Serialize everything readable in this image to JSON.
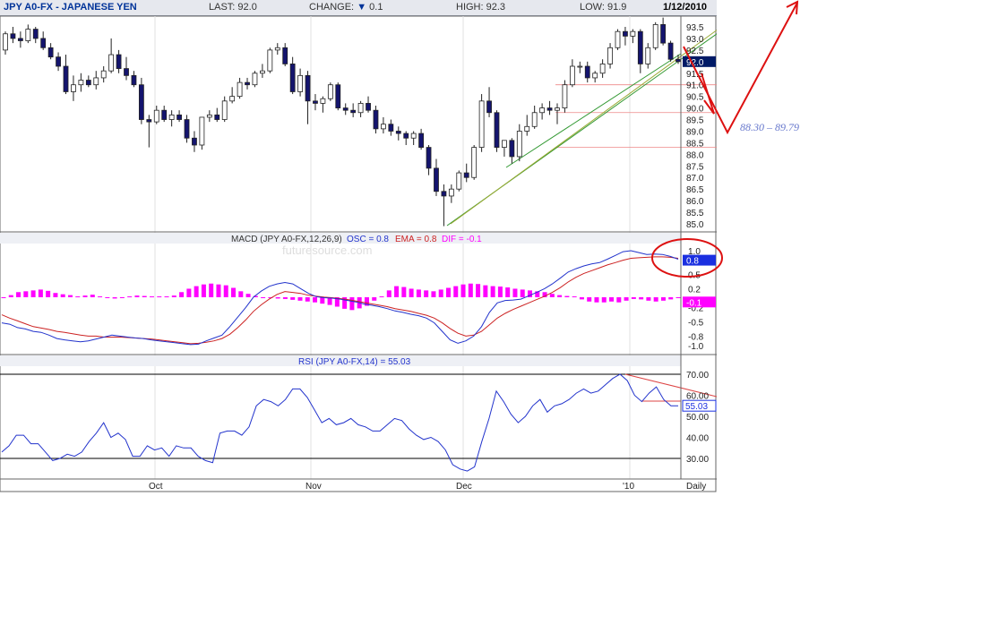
{
  "header": {
    "symbol": "JPY A0-FX - JAPANESE YEN",
    "last": "LAST: 92.0",
    "change_label": "CHANGE:",
    "change_arrow": "▼",
    "change_value": "0.1",
    "high": "HIGH: 92.3",
    "low": "LOW: 91.9",
    "date": "1/12/2010"
  },
  "watermark": "futuresource.com",
  "annotation": {
    "range": "88.30 – 89.79"
  },
  "colors": {
    "up_fill": "#ffffff",
    "down_fill": "#14146e",
    "macd": "#2233cc",
    "ema": "#cc2222",
    "dif": "#ff00ff",
    "rsi": "#2233cc",
    "annot": "#dd1111",
    "green_line": "#339933",
    "olive_line": "#99aa33"
  },
  "chart_data": [
    {
      "type": "candlestick",
      "title": "JPY A0-FX - JAPANESE YEN",
      "x_labels": [
        "Oct",
        "Nov",
        "Dec",
        "'10",
        "Daily"
      ],
      "y_ticks": [
        "93.5",
        "93.0",
        "92.5",
        "92.0",
        "91.5",
        "91.0",
        "90.5",
        "90.0",
        "89.5",
        "89.0",
        "88.5",
        "88.0",
        "87.5",
        "87.0",
        "86.5",
        "86.0",
        "85.5",
        "85.0"
      ],
      "ylim": [
        84.8,
        93.8
      ],
      "last_value_label": "92.0",
      "ohlc": [
        [
          92.5,
          93.3,
          92.3,
          93.2
        ],
        [
          93.2,
          93.5,
          92.8,
          93.0
        ],
        [
          93.0,
          93.3,
          92.6,
          92.9
        ],
        [
          92.9,
          93.6,
          92.8,
          93.4
        ],
        [
          93.4,
          93.5,
          92.8,
          93.0
        ],
        [
          93.0,
          93.3,
          92.5,
          92.6
        ],
        [
          92.6,
          92.8,
          92.1,
          92.2
        ],
        [
          92.2,
          92.4,
          91.6,
          91.8
        ],
        [
          91.8,
          92.3,
          90.6,
          90.7
        ],
        [
          90.7,
          91.4,
          90.3,
          91.0
        ],
        [
          91.0,
          91.5,
          90.7,
          91.2
        ],
        [
          91.2,
          91.4,
          90.9,
          91.0
        ],
        [
          91.0,
          91.6,
          90.8,
          91.3
        ],
        [
          91.3,
          91.8,
          91.1,
          91.6
        ],
        [
          91.6,
          93.0,
          91.5,
          92.3
        ],
        [
          92.3,
          92.5,
          91.5,
          91.7
        ],
        [
          91.7,
          92.2,
          91.2,
          91.4
        ],
        [
          91.4,
          91.6,
          90.9,
          91.0
        ],
        [
          91.0,
          91.3,
          89.3,
          89.5
        ],
        [
          89.5,
          89.7,
          88.3,
          89.4
        ],
        [
          89.4,
          90.1,
          89.3,
          89.9
        ],
        [
          89.9,
          90.1,
          89.4,
          89.5
        ],
        [
          89.5,
          89.9,
          89.2,
          89.7
        ],
        [
          89.7,
          89.9,
          89.4,
          89.5
        ],
        [
          89.5,
          89.7,
          88.5,
          88.7
        ],
        [
          88.7,
          89.0,
          88.1,
          88.4
        ],
        [
          88.4,
          89.6,
          88.2,
          89.6
        ],
        [
          89.6,
          89.9,
          89.4,
          89.7
        ],
        [
          89.7,
          90.0,
          89.4,
          89.5
        ],
        [
          89.5,
          90.5,
          89.4,
          90.3
        ],
        [
          90.3,
          90.9,
          90.2,
          90.5
        ],
        [
          90.5,
          91.3,
          90.4,
          91.1
        ],
        [
          91.1,
          91.3,
          90.8,
          91.0
        ],
        [
          91.0,
          91.6,
          90.9,
          91.5
        ],
        [
          91.5,
          91.9,
          91.3,
          91.6
        ],
        [
          91.6,
          92.6,
          91.5,
          92.5
        ],
        [
          92.5,
          92.8,
          92.3,
          92.6
        ],
        [
          92.6,
          92.8,
          91.8,
          91.9
        ],
        [
          91.9,
          92.2,
          90.6,
          90.7
        ],
        [
          90.7,
          91.7,
          90.5,
          91.4
        ],
        [
          91.4,
          91.6,
          89.3,
          90.3
        ],
        [
          90.3,
          90.6,
          89.9,
          90.2
        ],
        [
          90.2,
          90.5,
          89.8,
          90.4
        ],
        [
          90.4,
          91.1,
          90.3,
          91.0
        ],
        [
          91.0,
          91.1,
          89.9,
          90.0
        ],
        [
          90.0,
          90.2,
          89.7,
          89.9
        ],
        [
          89.9,
          90.2,
          89.6,
          89.8
        ],
        [
          89.8,
          90.3,
          89.6,
          90.2
        ],
        [
          90.2,
          90.5,
          89.8,
          89.9
        ],
        [
          89.9,
          90.1,
          88.9,
          89.1
        ],
        [
          89.1,
          89.6,
          88.9,
          89.3
        ],
        [
          89.3,
          89.5,
          88.8,
          89.0
        ],
        [
          89.0,
          89.2,
          88.6,
          88.9
        ],
        [
          88.9,
          89.0,
          88.4,
          88.7
        ],
        [
          88.7,
          89.0,
          88.4,
          88.9
        ],
        [
          88.9,
          89.1,
          88.2,
          88.3
        ],
        [
          88.3,
          88.4,
          87.1,
          87.4
        ],
        [
          87.4,
          87.8,
          86.2,
          86.4
        ],
        [
          86.4,
          86.7,
          84.9,
          86.2
        ],
        [
          86.2,
          86.7,
          85.9,
          86.5
        ],
        [
          86.5,
          87.3,
          86.4,
          87.2
        ],
        [
          87.2,
          87.6,
          86.8,
          87.0
        ],
        [
          87.0,
          88.4,
          86.9,
          88.3
        ],
        [
          88.3,
          90.6,
          88.1,
          90.3
        ],
        [
          90.3,
          90.9,
          89.6,
          89.8
        ],
        [
          89.8,
          89.9,
          88.1,
          88.3
        ],
        [
          88.3,
          88.6,
          87.9,
          88.6
        ],
        [
          88.6,
          88.7,
          87.6,
          87.9
        ],
        [
          87.9,
          89.3,
          87.7,
          89.0
        ],
        [
          89.0,
          89.7,
          88.8,
          89.2
        ],
        [
          89.2,
          90.1,
          89.1,
          89.8
        ],
        [
          89.8,
          90.2,
          89.5,
          90.0
        ],
        [
          90.0,
          90.3,
          89.7,
          89.9
        ],
        [
          89.9,
          90.2,
          89.3,
          90.0
        ],
        [
          90.0,
          91.2,
          89.8,
          91.0
        ],
        [
          91.0,
          92.1,
          90.9,
          91.8
        ],
        [
          91.8,
          92.0,
          91.5,
          91.8
        ],
        [
          91.8,
          92.0,
          91.1,
          91.3
        ],
        [
          91.3,
          91.6,
          91.1,
          91.5
        ],
        [
          91.5,
          92.1,
          91.3,
          91.9
        ],
        [
          91.9,
          92.8,
          91.7,
          92.6
        ],
        [
          92.6,
          93.4,
          92.5,
          93.3
        ],
        [
          93.3,
          93.5,
          92.7,
          93.1
        ],
        [
          93.1,
          93.4,
          92.8,
          93.3
        ],
        [
          93.3,
          93.4,
          91.5,
          91.9
        ],
        [
          91.9,
          92.8,
          91.7,
          92.6
        ],
        [
          92.6,
          93.7,
          92.5,
          93.6
        ],
        [
          93.6,
          93.9,
          92.7,
          92.8
        ],
        [
          92.8,
          92.9,
          92.0,
          92.1
        ],
        [
          92.1,
          92.3,
          91.9,
          92.0
        ]
      ],
      "annotations": {
        "green_trend": [
          [
            499,
            252
          ],
          [
            849,
            3
          ]
        ],
        "olive_trend": [
          [
            499,
            252
          ],
          [
            849,
            3
          ]
        ],
        "lower_trend": [
          [
            565,
            187
          ],
          [
            760,
            60
          ]
        ],
        "red_hlines": [
          "91.0",
          "89.8",
          "88.3"
        ]
      }
    },
    {
      "type": "histogram_line",
      "title": "MACD (JPY A0-FX,12,26,9)",
      "legend": [
        "OSC = 0.8",
        "EMA = 0.8",
        "DIF = -0.1"
      ],
      "y_ticks": [
        "1.0",
        "0.5",
        "0.2",
        "-0.2",
        "-0.5",
        "-0.8",
        "-1.0"
      ],
      "ylim": [
        -1.1,
        1.1
      ],
      "value_labels": [
        "0.8",
        "-0.1"
      ],
      "macd": [
        -0.52,
        -0.55,
        -0.62,
        -0.65,
        -0.7,
        -0.72,
        -0.78,
        -0.85,
        -0.88,
        -0.9,
        -0.92,
        -0.9,
        -0.86,
        -0.82,
        -0.78,
        -0.8,
        -0.82,
        -0.84,
        -0.85,
        -0.88,
        -0.9,
        -0.92,
        -0.94,
        -0.96,
        -0.98,
        -0.97,
        -0.9,
        -0.84,
        -0.78,
        -0.6,
        -0.4,
        -0.2,
        0.02,
        0.15,
        0.25,
        0.3,
        0.33,
        0.3,
        0.2,
        0.1,
        0.03,
        0.01,
        0.0,
        -0.02,
        -0.05,
        -0.08,
        -0.12,
        -0.15,
        -0.18,
        -0.22,
        -0.27,
        -0.3,
        -0.34,
        -0.37,
        -0.42,
        -0.52,
        -0.7,
        -0.88,
        -0.95,
        -0.9,
        -0.8,
        -0.6,
        -0.3,
        -0.1,
        -0.05,
        -0.04,
        -0.02,
        0.05,
        0.12,
        0.2,
        0.3,
        0.42,
        0.55,
        0.62,
        0.68,
        0.72,
        0.75,
        0.82,
        0.9,
        0.98,
        1.0,
        0.96,
        0.92,
        0.93,
        0.92,
        0.88,
        0.82
      ],
      "ema": [
        -0.35,
        -0.42,
        -0.48,
        -0.54,
        -0.6,
        -0.63,
        -0.66,
        -0.7,
        -0.72,
        -0.75,
        -0.78,
        -0.8,
        -0.8,
        -0.82,
        -0.82,
        -0.82,
        -0.83,
        -0.84,
        -0.85,
        -0.86,
        -0.88,
        -0.9,
        -0.92,
        -0.94,
        -0.96,
        -0.95,
        -0.93,
        -0.9,
        -0.85,
        -0.76,
        -0.62,
        -0.46,
        -0.28,
        -0.14,
        -0.02,
        0.08,
        0.14,
        0.12,
        0.1,
        0.06,
        0.04,
        0.02,
        0.01,
        -0.01,
        -0.03,
        -0.06,
        -0.09,
        -0.12,
        -0.15,
        -0.18,
        -0.22,
        -0.25,
        -0.28,
        -0.32,
        -0.36,
        -0.42,
        -0.52,
        -0.64,
        -0.74,
        -0.8,
        -0.78,
        -0.7,
        -0.56,
        -0.42,
        -0.32,
        -0.24,
        -0.17,
        -0.1,
        -0.03,
        0.04,
        0.12,
        0.22,
        0.34,
        0.44,
        0.52,
        0.58,
        0.64,
        0.7,
        0.75,
        0.8,
        0.84,
        0.85,
        0.86,
        0.87,
        0.87,
        0.86,
        0.84
      ],
      "hist": [
        -0.02,
        0.05,
        0.12,
        0.14,
        0.16,
        0.18,
        0.15,
        0.1,
        0.07,
        0.05,
        0.02,
        0.04,
        0.06,
        0.02,
        -0.02,
        -0.03,
        0.0,
        0.02,
        0.04,
        0.03,
        0.02,
        0.02,
        0.02,
        0.04,
        0.12,
        0.2,
        0.26,
        0.3,
        0.32,
        0.3,
        0.28,
        0.22,
        0.14,
        0.08,
        0.03,
        -0.01,
        -0.02,
        -0.03,
        -0.04,
        -0.06,
        -0.08,
        -0.1,
        -0.12,
        -0.15,
        -0.18,
        -0.22,
        -0.27,
        -0.3,
        -0.26,
        -0.2,
        -0.08,
        0.02,
        0.16,
        0.26,
        0.24,
        0.2,
        0.18,
        0.16,
        0.14,
        0.18,
        0.22,
        0.26,
        0.3,
        0.32,
        0.31,
        0.28,
        0.26,
        0.25,
        0.23,
        0.2,
        0.18,
        0.16,
        0.14,
        0.12,
        0.08,
        0.05,
        0.03,
        0.02,
        -0.05,
        -0.1,
        -0.12,
        -0.12,
        -0.1,
        -0.12,
        -0.08,
        -0.04,
        -0.05,
        -0.08,
        -0.1,
        -0.08,
        -0.05,
        -0.02
      ]
    },
    {
      "type": "line",
      "title": "RSI (JPY A0-FX,14) = 55.03",
      "y_ticks": [
        "70.00",
        "60.00",
        "50.00",
        "40.00",
        "30.00"
      ],
      "ylim": [
        20,
        73
      ],
      "value_label": "55.03",
      "ref_lines": [
        70,
        30
      ],
      "values": [
        33,
        36,
        41,
        41,
        37,
        37,
        33,
        29,
        30,
        32,
        31,
        33,
        38,
        42,
        47,
        40,
        42,
        39,
        31,
        31,
        36,
        34,
        35,
        31,
        36,
        35,
        35,
        31,
        29,
        28,
        42,
        43,
        43,
        41,
        45,
        55,
        58,
        57,
        55,
        58,
        63,
        63,
        59,
        53,
        47,
        49,
        46,
        47,
        49,
        46,
        45,
        43,
        43,
        46,
        49,
        48,
        44,
        41,
        39,
        40,
        38,
        34,
        27,
        25,
        24,
        26,
        38,
        49,
        62,
        57,
        51,
        47,
        50,
        55,
        58,
        52,
        55,
        56,
        58,
        61,
        63,
        61,
        62,
        65,
        68,
        70,
        67,
        60,
        57,
        61,
        64,
        58,
        55,
        55.03
      ]
    }
  ]
}
